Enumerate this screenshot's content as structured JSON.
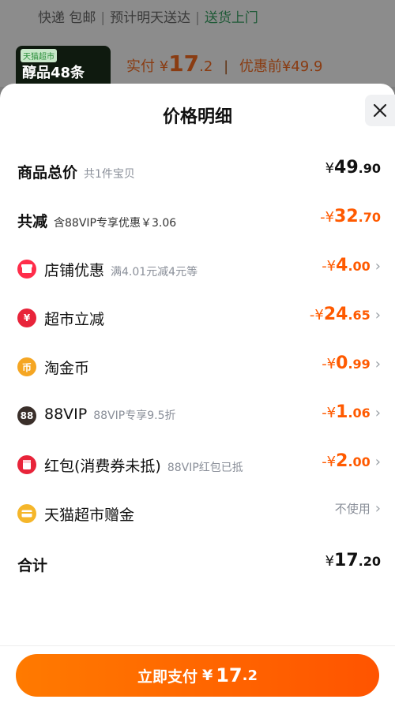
{
  "background": {
    "shipping": "快递 包邮",
    "estimate": "预计明天送达",
    "delivery": "送货上门",
    "thumb_badge": "天猫超市",
    "thumb_text": "醇品48条",
    "paid_label": "实付",
    "paid_currency": "¥",
    "paid_int": "17",
    "paid_dec": ".2",
    "before_label": "优惠前¥49.9"
  },
  "sheet": {
    "title": "价格明细",
    "close_icon": "close-icon"
  },
  "rows": {
    "total": {
      "label": "商品总价",
      "sub": "共1件宝贝",
      "currency": "¥",
      "int": "49",
      "dec": ".90"
    },
    "reduce": {
      "label": "共减",
      "sub": "含88VIP专享优惠￥3.06",
      "currency": "-¥",
      "int": "32",
      "dec": ".70"
    },
    "store": {
      "label": "店铺优惠",
      "sub": "满4.01元减4元等",
      "currency": "-¥",
      "int": "4",
      "dec": ".00",
      "icon_color": "#ff2d4a"
    },
    "market": {
      "label": "超市立减",
      "currency": "-¥",
      "int": "24",
      "dec": ".65",
      "icon_color": "#e8243a"
    },
    "coin": {
      "label": "淘金币",
      "currency": "-¥",
      "int": "0",
      "dec": ".99",
      "icon_color": "#f5a623"
    },
    "vip": {
      "label": "88VIP",
      "sub": "88VIP专享9.5折",
      "currency": "-¥",
      "int": "1",
      "dec": ".06",
      "icon_text": "88",
      "icon_color": "#3a2f2a"
    },
    "redpack": {
      "label": "红包(消费券未抵)",
      "sub": "88VIP红包已抵",
      "currency": "-¥",
      "int": "2",
      "dec": ".00",
      "icon_color": "#e8243a"
    },
    "gift": {
      "label": "天猫超市赠金",
      "value_text": "不使用",
      "icon_color": "#f5b62a"
    },
    "sum": {
      "label": "合计",
      "currency": "¥",
      "int": "17",
      "dec": ".20"
    }
  },
  "footer": {
    "pay_label": "立即支付",
    "currency": "¥",
    "int": "17",
    "dec": ".2"
  }
}
